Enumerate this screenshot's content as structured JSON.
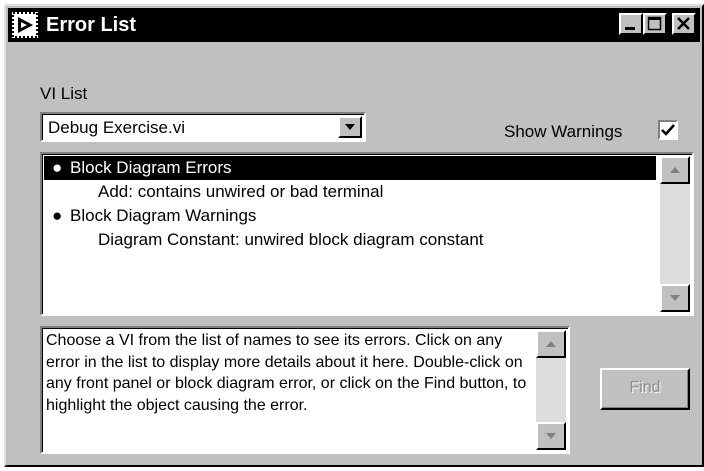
{
  "window": {
    "title": "Error List"
  },
  "vi_list": {
    "label": "VI List",
    "selected": "Debug Exercise.vi"
  },
  "show_warnings": {
    "label": "Show Warnings",
    "checked": true
  },
  "errors": [
    {
      "kind": "header",
      "text": "Block Diagram Errors",
      "selected": true
    },
    {
      "kind": "item",
      "text": "Add: contains unwired or bad terminal",
      "selected": false
    },
    {
      "kind": "header",
      "text": "Block Diagram Warnings",
      "selected": false
    },
    {
      "kind": "item",
      "text": "Diagram Constant: unwired block diagram constant",
      "selected": false
    }
  ],
  "details": {
    "text": "Choose a VI from the list of names to see its errors. Click on any error in the list to display more details about it here. Double-click on any front panel or block diagram error, or click on the Find button, to highlight the object causing the error."
  },
  "find_button": {
    "label": "Find",
    "enabled": false
  },
  "icons": {
    "window": "labview-run-arrow-icon",
    "minimize": "minimize-icon",
    "maximize": "maximize-icon",
    "close": "close-icon",
    "dropdown": "chevron-down-icon",
    "scroll_up": "scroll-up-arrow-icon",
    "scroll_down": "scroll-down-arrow-icon",
    "check": "check-icon"
  },
  "colors": {
    "window_bg": "#c0c0c0",
    "titlebar_bg": "#000000",
    "selection_bg": "#000000",
    "disabled_text": "#8a8a8a"
  }
}
